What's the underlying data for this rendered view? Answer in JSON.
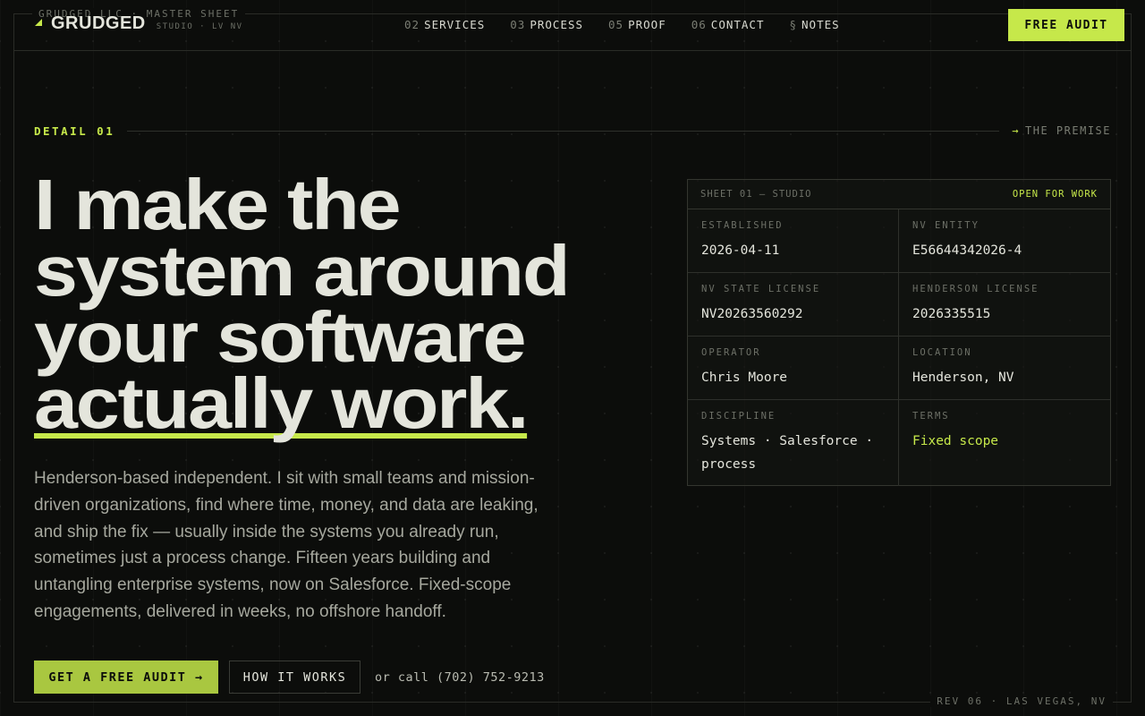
{
  "frame": {
    "top_label": "GRUDGED LLC · MASTER SHEET",
    "bottom_label": "REV 06 · LAS VEGAS, NV"
  },
  "header": {
    "logo_name": "GRUDGED",
    "logo_sub": "STUDIO · LV NV",
    "nav": [
      {
        "num": "02",
        "label": "SERVICES"
      },
      {
        "num": "03",
        "label": "PROCESS"
      },
      {
        "num": "05",
        "label": "PROOF"
      },
      {
        "num": "06",
        "label": "CONTACT"
      },
      {
        "num": "§",
        "label": "NOTES"
      }
    ],
    "cta_label": "FREE AUDIT"
  },
  "detail": {
    "label": "DETAIL 01",
    "right": "THE PREMISE",
    "right_arrow": "→"
  },
  "hero": {
    "title_lines": [
      "I make the",
      "system around",
      "your software",
      "actually work."
    ],
    "body": "Henderson-based independent. I sit with small teams and mission-driven organizations, find where time, money, and data are leaking, and ship the fix — usually inside the systems you already run, sometimes just a process change. Fifteen years building and untangling enterprise systems, now on Salesforce. Fixed-scope engagements, delivered in weeks, no offshore handoff.",
    "primary_cta": "GET A FREE AUDIT →",
    "secondary_cta": "HOW IT WORKS",
    "call_text": "or call (702) 752-9213"
  },
  "sheet": {
    "title": "SHEET 01 — STUDIO",
    "status": "OPEN FOR WORK",
    "cells": [
      {
        "label": "ESTABLISHED",
        "value": "2026-04-11"
      },
      {
        "label": "NV ENTITY",
        "value": "E56644342026-4"
      },
      {
        "label": "NV STATE LICENSE",
        "value": "NV20263560292"
      },
      {
        "label": "HENDERSON LICENSE",
        "value": "2026335515"
      },
      {
        "label": "OPERATOR",
        "value": "Chris Moore"
      },
      {
        "label": "LOCATION",
        "value": "Henderson, NV"
      },
      {
        "label": "DISCIPLINE",
        "value": "Systems · Salesforce · process"
      },
      {
        "label": "TERMS",
        "value": "Fixed scope"
      }
    ]
  },
  "colors": {
    "accent": "#c6e84a",
    "background": "#0c0d0b",
    "text": "#e4e5dc"
  }
}
